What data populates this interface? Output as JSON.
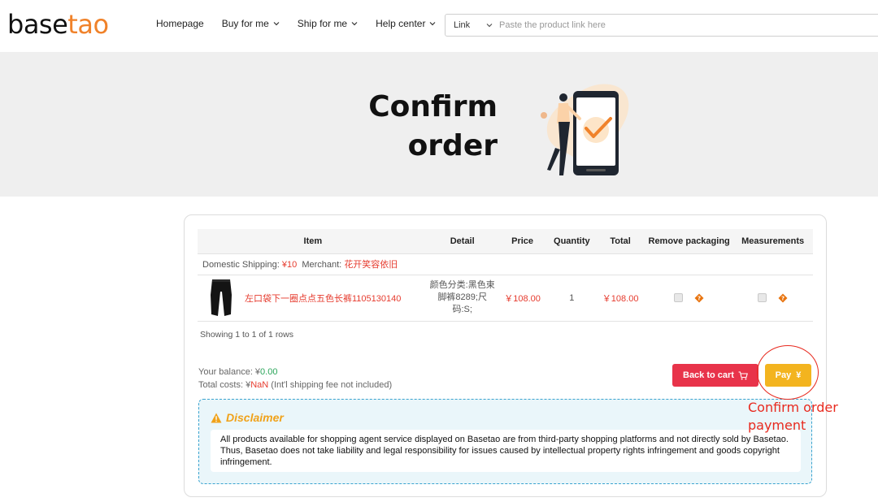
{
  "header": {
    "logo_part1": "base",
    "logo_part2": "tao",
    "nav": [
      {
        "label": "Homepage",
        "has_dropdown": false
      },
      {
        "label": "Buy for me",
        "has_dropdown": true
      },
      {
        "label": "Ship for me",
        "has_dropdown": true
      },
      {
        "label": "Help center",
        "has_dropdown": true
      }
    ],
    "search": {
      "select_value": "Link",
      "placeholder": "Paste the product link here",
      "value": ""
    }
  },
  "banner": {
    "title_line1": "Confirm",
    "title_line2": "order"
  },
  "table": {
    "headers": [
      "Item",
      "Detail",
      "Price",
      "Quantity",
      "Total",
      "Remove packaging",
      "Measurements"
    ],
    "shipping_label": "Domestic Shipping:",
    "shipping_value": "¥10",
    "merchant_label": "Merchant:",
    "merchant_value": "花开笑容依旧",
    "rows": [
      {
        "name": "左口袋下一圈点点五色长裤1105130140",
        "detail": "颜色分类:黑色束脚裤8289;尺码:S;",
        "price": "￥108.00",
        "quantity": "1",
        "total": "￥108.00",
        "remove_packaging": false,
        "measurements": false
      }
    ],
    "showing": "Showing 1 to 1 of 1 rows"
  },
  "summary": {
    "balance_label": "Your balance: ¥",
    "balance_value": "0.00",
    "costs_label": "Total costs: ¥",
    "costs_value": "NaN",
    "costs_note": "(Int'l shipping fee not included)"
  },
  "buttons": {
    "back_to_cart": "Back to cart",
    "pay": "Pay",
    "pay_symbol": "¥"
  },
  "disclaimer": {
    "title": "Disclaimer",
    "text": "All products available for shopping agent service displayed on Basetao are from third-party shopping platforms and not directly sold by Basetao. Thus, Basetao does not take liability and legal responsibility for issues caused by intellectual property rights infringement and goods copyright infringement."
  },
  "annotation": {
    "line1": "Confirm order",
    "line2": "payment"
  },
  "colors": {
    "brand_orange": "#f0822a",
    "back_button": "#e8334a",
    "pay_button": "#f3b41f",
    "annotation": "#e82a1f",
    "disclaimer_border": "#3aa3cf"
  }
}
